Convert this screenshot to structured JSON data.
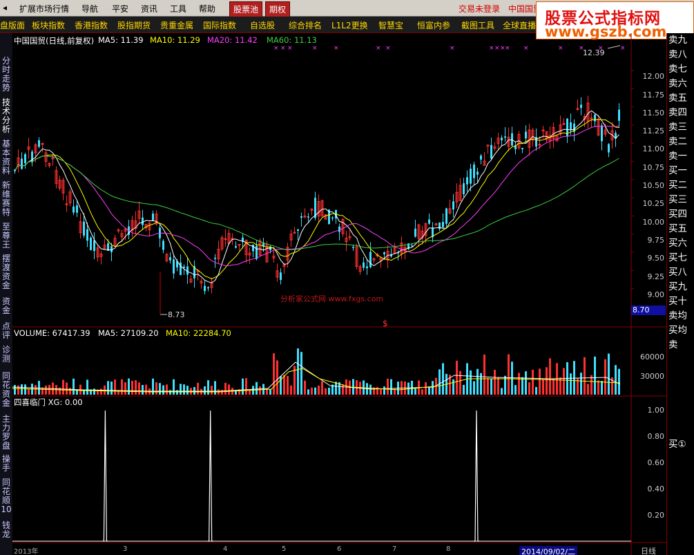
{
  "menu": {
    "items": [
      "扩展市场行情",
      "导航",
      "平安",
      "资讯",
      "工具",
      "帮助"
    ],
    "highlighted": [
      "股票池",
      "期权"
    ],
    "status_right": "交易未登录",
    "stock_right": "中国国贸"
  },
  "brand": {
    "line1": "股票公式指标网",
    "line2": "www.gszb.com"
  },
  "tabs": [
    "盘版面",
    "板块指数",
    "香港指数",
    "股指期货",
    "贵重金属",
    "国际指数",
    "自选股",
    "综合排名",
    "L1L2更换",
    "智慧宝",
    "恒富内参",
    "截图工具",
    "全球直播"
  ],
  "left_nav": [
    "分时走势",
    "技术分析",
    "基本资料",
    "新维赛特",
    "至尊王",
    "摆渡资金",
    "资金",
    "点评",
    "诊测",
    "同花资金",
    "主力罗盘",
    "操手",
    "同花顺10",
    "钱龙"
  ],
  "right_panel": [
    "卖九",
    "卖八",
    "卖七",
    "卖六",
    "卖五",
    "卖四",
    "卖三",
    "卖二",
    "卖一",
    "买一",
    "买二",
    "买三",
    "买四",
    "买五",
    "买六",
    "买七",
    "买八",
    "买九",
    "买十",
    "卖均",
    "买均",
    "卖"
  ],
  "right_panel_ind": "买①",
  "main_chart": {
    "title": "中国国贸(日线,前复权)",
    "ma5": "MA5: 11.39",
    "ma10": "MA10: 11.29",
    "ma20": "MA20: 11.42",
    "ma60": "MA60: 11.13",
    "y_ticks": [
      "12.00",
      "11.75",
      "11.50",
      "11.25",
      "11.00",
      "10.75",
      "10.50",
      "10.25",
      "10.00",
      "9.75",
      "9.50",
      "9.25",
      "9.00"
    ],
    "high_label": "12.39",
    "low_label": "8.73",
    "current_price": "8.70",
    "watermark": "分析家公式网 www.fxgs.com",
    "colors": {
      "up": "#ff3030",
      "down": "#40e0ff",
      "ma5": "#ffffff",
      "ma10": "#ffff00",
      "ma20": "#ff40ff",
      "ma60": "#40d040"
    }
  },
  "volume_chart": {
    "title": "VOLUME: 67417.39",
    "ma5": "MA5: 27109.20",
    "ma10": "MA10: 22284.70",
    "y_ticks": [
      "60000",
      "30000"
    ]
  },
  "indicator_chart": {
    "title": "四喜临门 XG: 0.00",
    "y_ticks": [
      "1.00",
      "0.80",
      "0.60",
      "0.40",
      "0.20"
    ],
    "signal_positions": [
      0.15,
      0.32,
      0.75
    ]
  },
  "x_axis": {
    "labels": [
      "2013年",
      "3",
      "4",
      "5",
      "6",
      "7",
      "8"
    ],
    "date": "2014/09/02/二",
    "period": "日线"
  }
}
